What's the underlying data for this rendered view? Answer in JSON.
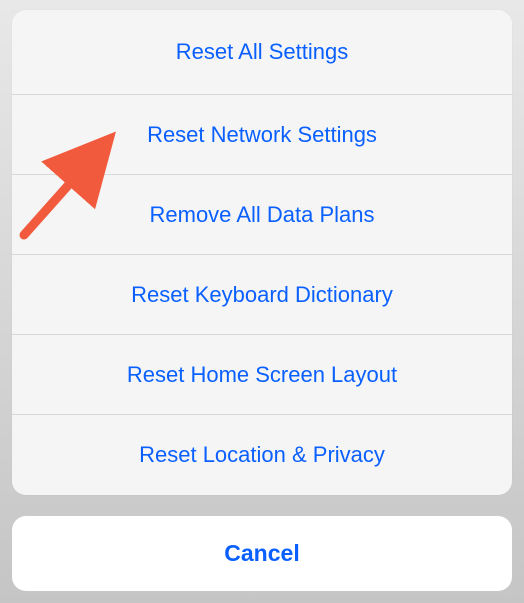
{
  "sheet": {
    "options": [
      {
        "label": "Reset All Settings"
      },
      {
        "label": "Reset Network Settings"
      },
      {
        "label": "Remove All Data Plans"
      },
      {
        "label": "Reset Keyboard Dictionary"
      },
      {
        "label": "Reset Home Screen Layout"
      },
      {
        "label": "Reset Location & Privacy"
      }
    ]
  },
  "cancel": {
    "label": "Cancel"
  },
  "annotation": {
    "arrow_color": "#f15a3c"
  }
}
